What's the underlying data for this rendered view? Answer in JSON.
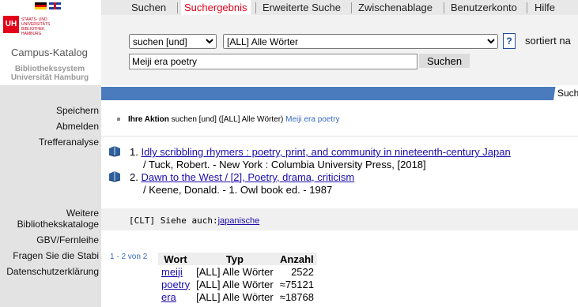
{
  "left_nav": {
    "items": [
      "Speichern",
      "Abmelden",
      "Trefferanalyse"
    ],
    "items2": [
      "Weitere",
      "Bibliothekskataloge",
      "GBV/Fernleihe",
      "Fragen Sie die Stabi",
      "Datenschutzerklärung"
    ]
  },
  "logo": {
    "uh": "UH",
    "uh_text": "STAATS- UND UNIVERSITÄTS BIBLIOTHEK HAMBURG",
    "campus": "Campus-Katalog",
    "subtitle_line1": "Bibliothekssystem",
    "subtitle_line2": "Universität Hamburg"
  },
  "tabs": [
    "Suchen",
    "Suchergebnis",
    "Erweiterte Suche",
    "Zwischenablage",
    "Benutzerkonto",
    "Hilfe"
  ],
  "search": {
    "mode": "suchen [und]",
    "field": "[ALL] Alle Wörter",
    "help": "?",
    "sort_label": "sortiert na",
    "query": "Meiji era poetry",
    "button": "Suchen"
  },
  "band_text": "Such",
  "action": {
    "label": "Ihre Aktion",
    "text": "suchen [und] ([ALL] Alle Wörter)",
    "query": "Meiji era poetry"
  },
  "results": [
    {
      "num": "1.",
      "title": "Idly scribbling rhymers : poetry, print, and community in nineteenth-century Japan",
      "details": "/ Tuck, Robert. - New York : Columbia University Press, [2018]"
    },
    {
      "num": "2.",
      "title": "Dawn to the West / [2], Poetry, drama, criticism",
      "details": "/ Keene, Donald. - 1. Owl book ed. - 1987"
    }
  ],
  "clt": {
    "prefix": "[CLT] Siehe auch:",
    "link": "japanische"
  },
  "range": "1 - 2 von 2",
  "table": {
    "headers": [
      "Wort",
      "Typ",
      "Anzahl"
    ],
    "rows": [
      {
        "wort": "meiji",
        "typ": "[ALL] Alle Wörter",
        "anzahl": "2522"
      },
      {
        "wort": "poetry",
        "typ": "[ALL] Alle Wörter",
        "anzahl": "≈75121"
      },
      {
        "wort": "era",
        "typ": "[ALL] Alle Wörter",
        "anzahl": "≈18768"
      }
    ]
  },
  "colors": {
    "accent": "#e2001a",
    "band": "#4a7bbd",
    "link": "#1a0dab"
  }
}
